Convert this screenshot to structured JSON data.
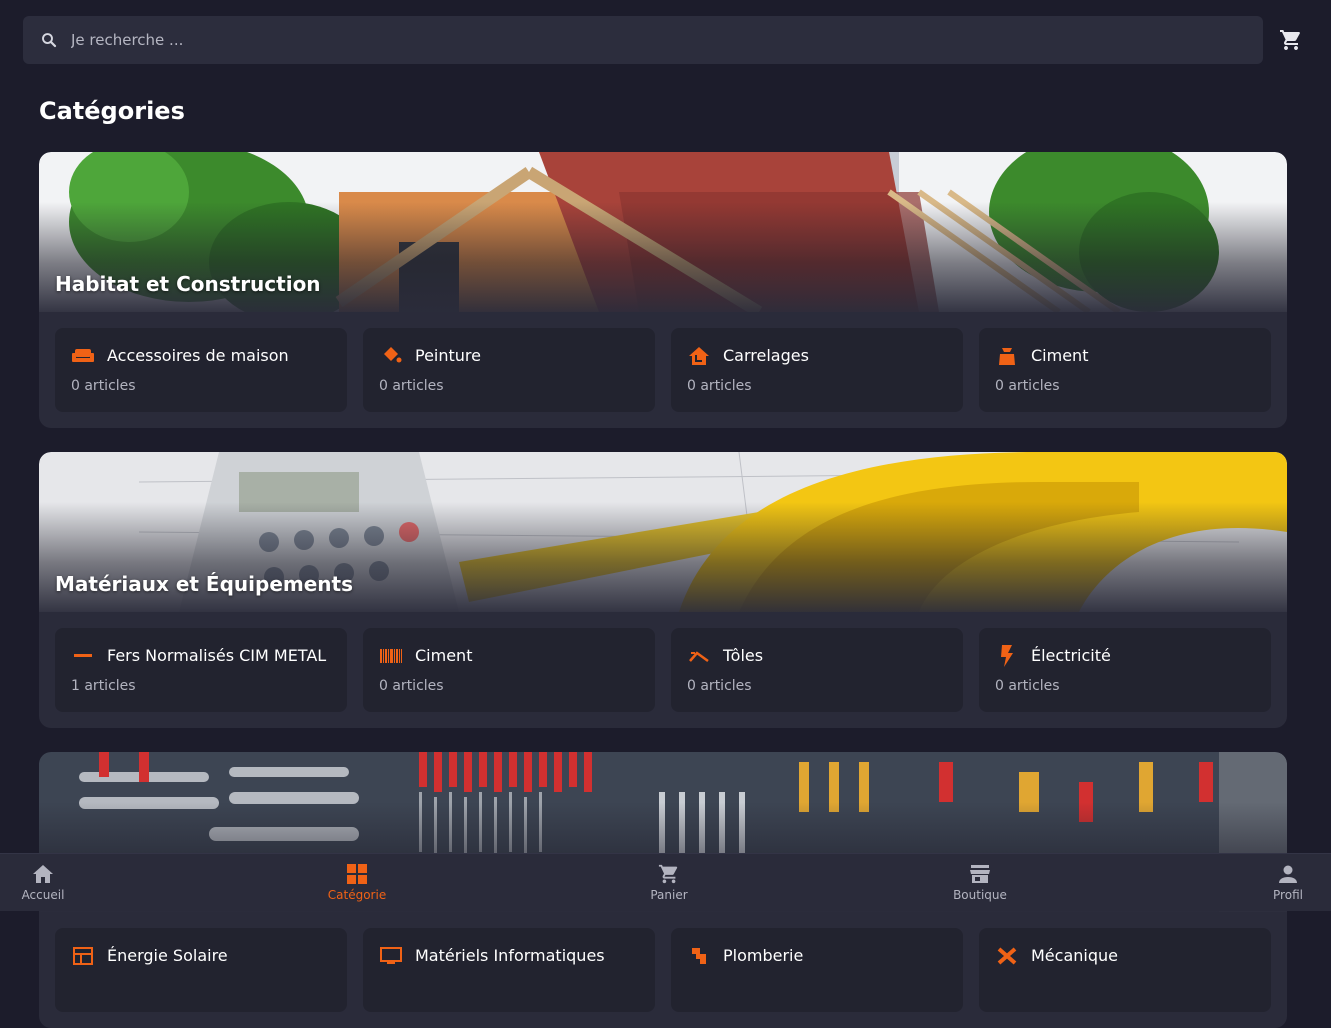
{
  "colors": {
    "accent": "#f06216",
    "background": "#1c1c2b",
    "card": "#22232f",
    "section": "#2a2b3a"
  },
  "search": {
    "placeholder": "Je recherche ...",
    "value": ""
  },
  "page_title": "Catégories",
  "sections": [
    {
      "title": "Habitat et Construction",
      "items": [
        {
          "name": "Accessoires de maison",
          "count": "0 articles",
          "icon": "sofa-icon"
        },
        {
          "name": "Peinture",
          "count": "0 articles",
          "icon": "paint-bucket-icon"
        },
        {
          "name": "Carrelages",
          "count": "0 articles",
          "icon": "house-tile-icon"
        },
        {
          "name": "Ciment",
          "count": "0 articles",
          "icon": "cement-bag-icon"
        }
      ]
    },
    {
      "title": "Matériaux et Équipements",
      "items": [
        {
          "name": "Fers Normalisés CIM METAL",
          "count": "1 articles",
          "icon": "dash-icon"
        },
        {
          "name": "Ciment",
          "count": "0 articles",
          "icon": "barcode-icon"
        },
        {
          "name": "Tôles",
          "count": "0 articles",
          "icon": "roof-icon"
        },
        {
          "name": "Électricité",
          "count": "0 articles",
          "icon": "lightning-icon"
        }
      ]
    },
    {
      "title": "",
      "items": [
        {
          "name": "Énergie Solaire",
          "count": "",
          "icon": "solar-panel-icon"
        },
        {
          "name": "Matériels Informatiques",
          "count": "",
          "icon": "monitor-icon"
        },
        {
          "name": "Plomberie",
          "count": "",
          "icon": "pipe-icon"
        },
        {
          "name": "Mécanique",
          "count": "",
          "icon": "wrench-icon"
        }
      ]
    }
  ],
  "nav": [
    {
      "label": "Accueil",
      "icon": "home-icon",
      "active": false
    },
    {
      "label": "Catégorie",
      "icon": "grid-icon",
      "active": true
    },
    {
      "label": "Panier",
      "icon": "cart-icon",
      "active": false
    },
    {
      "label": "Boutique",
      "icon": "store-icon",
      "active": false
    },
    {
      "label": "Profil",
      "icon": "person-icon",
      "active": false
    }
  ]
}
